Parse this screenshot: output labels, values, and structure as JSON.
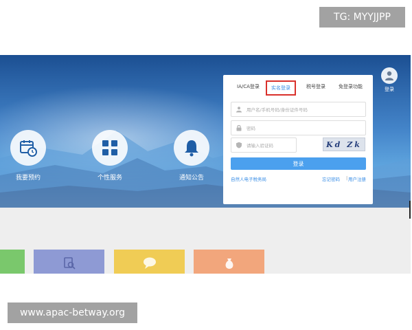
{
  "watermark_top": "TG: MYYJJPP",
  "watermark_bottom": "www.apac-betway.org",
  "features": [
    {
      "label": "我要预约",
      "icon": "calendar-clock-icon"
    },
    {
      "label": "个性服务",
      "icon": "grid-icon"
    },
    {
      "label": "通知公告",
      "icon": "bell-icon"
    }
  ],
  "user_corner": {
    "label": "登录",
    "icon": "user-icon"
  },
  "login": {
    "tabs": [
      "IA/CA登录",
      "实名登录",
      "税号登录",
      "免登录功能"
    ],
    "active_tab": "实名登录",
    "username_placeholder": "用户名/手机号码/身份证件号码",
    "password_placeholder": "密码",
    "captcha_placeholder": "请输入验证码",
    "captcha_text": "Kd Zk",
    "login_button": "登录",
    "links": {
      "register_natural_person": "自然人电子税务局",
      "forgot_password": "忘记密码",
      "separator": "|",
      "user_register": "用户注册"
    }
  },
  "tiles": [
    {
      "color": "#7ac86c",
      "icon": "none"
    },
    {
      "color": "#8e9ad4",
      "icon": "document-search-icon"
    },
    {
      "color": "#f0cc55",
      "icon": "chat-bubble-icon"
    },
    {
      "color": "#f2a67c",
      "icon": "money-bag-icon"
    }
  ],
  "colors": {
    "accent": "#3a8ee6",
    "highlight": "#d9302b",
    "hero": "#2a73c1"
  }
}
